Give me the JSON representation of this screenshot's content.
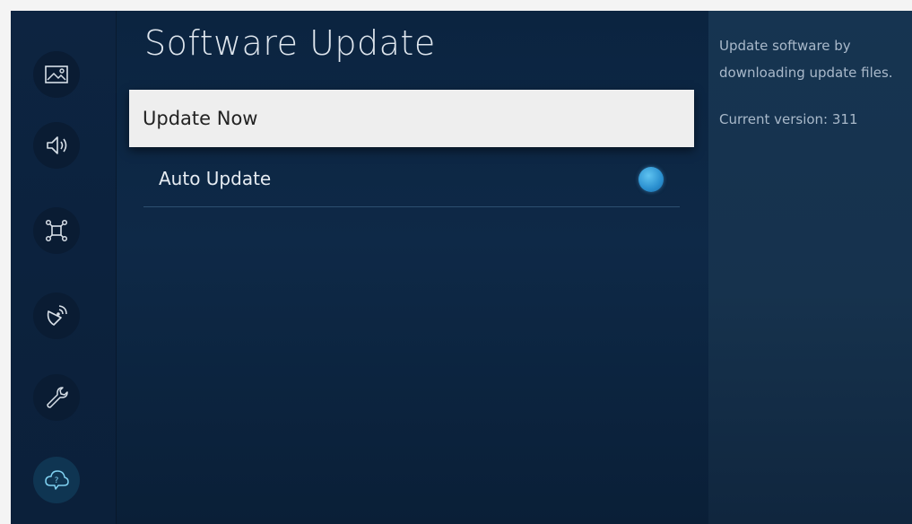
{
  "sidebar": {
    "items": [
      {
        "icon": "picture-icon"
      },
      {
        "icon": "sound-icon"
      },
      {
        "icon": "network-icon"
      },
      {
        "icon": "broadcasting-icon"
      },
      {
        "icon": "general-icon"
      },
      {
        "icon": "support-icon"
      }
    ],
    "active_index": 5
  },
  "main": {
    "title": "Software Update",
    "items": [
      {
        "label": "Update Now"
      },
      {
        "label": "Auto Update",
        "toggle_on": true
      }
    ]
  },
  "info": {
    "description": "Update software by downloading update files.",
    "current_version": "Current version: 311"
  },
  "colors": {
    "background": "#0e2947",
    "focus_item": "#eeeeee",
    "toggle_on": "#2a8fcf"
  }
}
